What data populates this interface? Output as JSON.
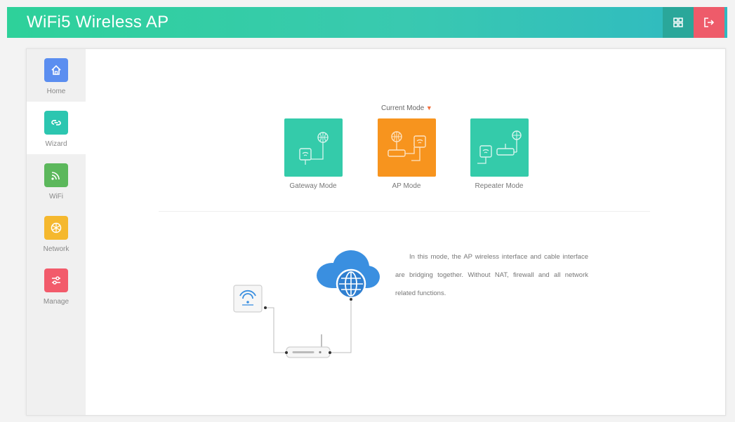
{
  "header": {
    "title": "WiFi5 Wireless AP",
    "grid_button": "grid-icon",
    "logout_button": "logout-icon"
  },
  "sidebar": {
    "items": [
      {
        "label": "Home",
        "icon": "home-icon",
        "color": "#5b8ef0"
      },
      {
        "label": "Wizard",
        "icon": "wizard-link-icon",
        "color": "#2cc6b0"
      },
      {
        "label": "WiFi",
        "icon": "wifi-icon",
        "color": "#5cb85c"
      },
      {
        "label": "Network",
        "icon": "network-icon",
        "color": "#f5b82e"
      },
      {
        "label": "Manage",
        "icon": "manage-sliders-icon",
        "color": "#f25b6b"
      }
    ],
    "active": "Wizard"
  },
  "main": {
    "current_mode_label": "Current Mode",
    "modes": [
      {
        "label": "Gateway Mode",
        "color": "#34cbaa"
      },
      {
        "label": "AP Mode",
        "color": "#f7941e",
        "selected": true
      },
      {
        "label": "Repeater Mode",
        "color": "#34cbaa"
      }
    ],
    "description": "In this mode, the AP wireless interface and cable interface are bridging together. Without NAT, firewall and all network related functions."
  }
}
